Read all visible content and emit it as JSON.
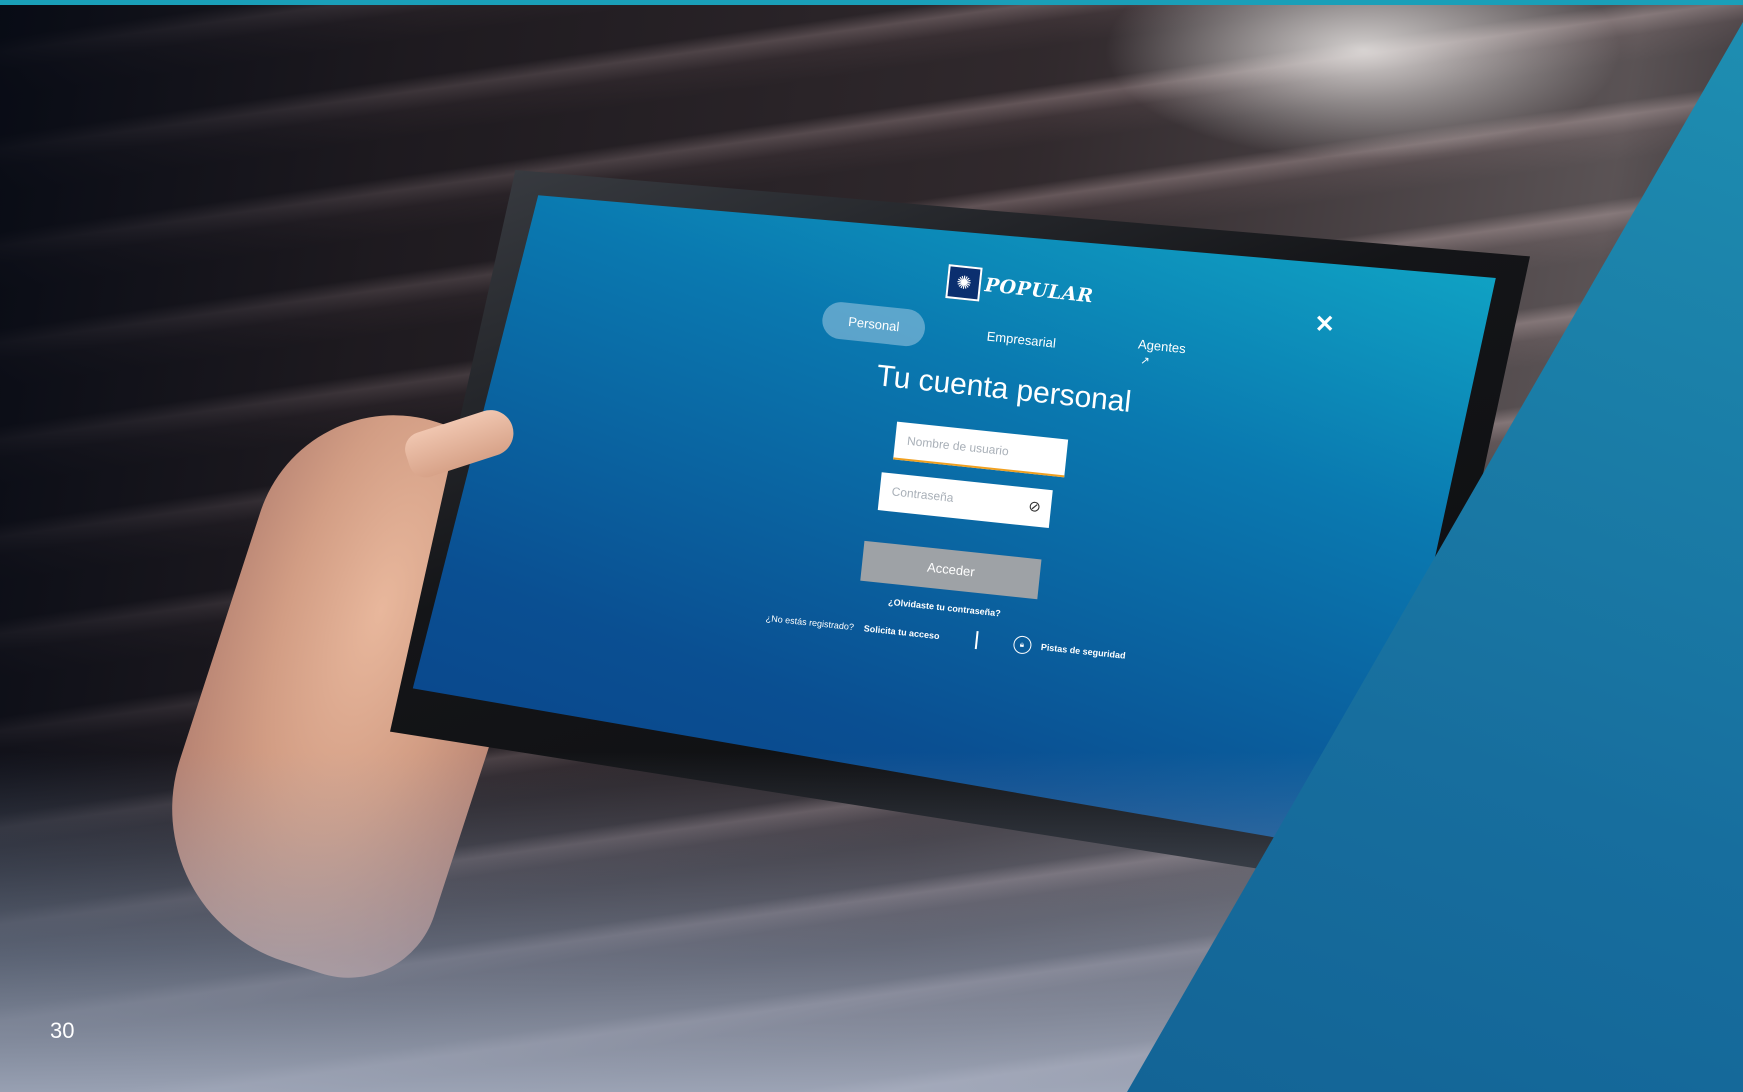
{
  "app": {
    "logo_text": "POPULAR",
    "tabs": [
      {
        "label": "Personal",
        "active": true
      },
      {
        "label": "Empresarial",
        "active": false
      },
      {
        "label": "Agentes",
        "active": false,
        "external": true
      }
    ],
    "title": "Tu cuenta personal",
    "username_placeholder": "Nombre de usuario",
    "password_placeholder": "Contraseña",
    "submit_label": "Acceder",
    "forgot_label": "¿Olvidaste tu contraseña?",
    "not_registered_label": "¿No estás registrado?",
    "request_access_label": "Solicita tu acceso",
    "security_tips_label": "Pistas de seguridad",
    "close_icon": "close-icon",
    "eye_icon": "eye-slash-icon"
  },
  "page": {
    "number": "30"
  },
  "colors": {
    "accent": "#1a9fb8",
    "panel": "#176e9e",
    "screen_top": "#12b3cc",
    "screen_bottom": "#0a3f86",
    "button": "#9ea2a6",
    "input_focus": "#f0a020"
  }
}
